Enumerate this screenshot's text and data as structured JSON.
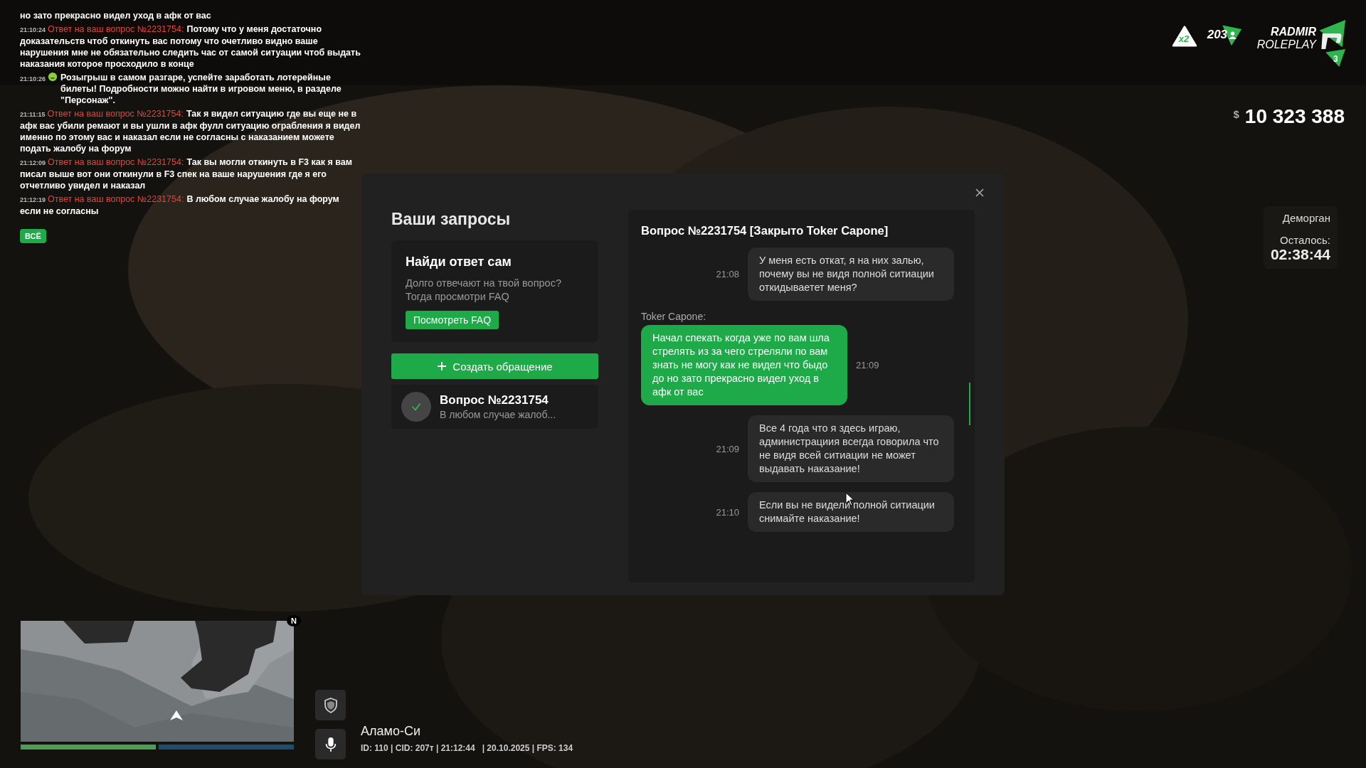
{
  "chat": {
    "messages": [
      {
        "icon": false,
        "text": "но зато прекрасно видел уход в афк от вас"
      },
      {
        "time": "21:10:24",
        "prefix": "Ответ на ваш вопрос №2231754:",
        "icon": false,
        "text": "Потому что у меня достаточно доказательств чтоб откинуть вас потому что очетливо видно ваше нарушения мне не обязательно следить час от самой ситуации чтоб выдать наказания которое просходило в конце"
      },
      {
        "time": "21:10:26",
        "icon": true,
        "text": "Розыгрыш в самом разгаре, успейте заработать лотерейные билеты! Подробности можно найти в игровом меню, в разделе \"Персонаж\"."
      },
      {
        "time": "21:11:15",
        "prefix": "Ответ на ваш вопрос №2231754:",
        "icon": false,
        "text": "Так я видел ситуацию где вы еще не в афк вас убили ремают и вы ушли в афк фулл ситуацию ограбления я видел именно по этому вас и наказал если не согласны с наказанием можете подать жалобу на форум"
      },
      {
        "time": "21:12:09",
        "prefix": "Ответ на ваш вопрос №2231754:",
        "icon": false,
        "text": "Так вы могли откинуть в F3 как я вам писал выше вот они откинули в F3 спек на ваше нарушения где я его отчетливо увидел и наказал"
      },
      {
        "time": "21:12:19",
        "prefix": "Ответ на ваш вопрос №2231754:",
        "icon": false,
        "text": "В любом случае жалобу на форум если не согласны"
      }
    ],
    "filter_button": "ВСЁ"
  },
  "hud": {
    "bonus_badge": "x2",
    "online": "203",
    "logo": {
      "name_top": "RADMIR",
      "name_bottom": "ROLEPLAY",
      "server": "3"
    },
    "money_symbol": "$",
    "money": "10 323 388",
    "jail": {
      "title": "Деморган",
      "remaining_label": "Осталось:",
      "remaining": "02:38:44"
    }
  },
  "modal": {
    "title": "Ваши запросы",
    "help_card": {
      "title": "Найди ответ сам",
      "text": "Долго отвечают на твой вопрос? Тогда просмотри FAQ",
      "button": "Посмотреть FAQ"
    },
    "create_button": "Создать обращение",
    "requests": [
      {
        "title": "Вопрос №2231754",
        "preview": "В любом случае жалоб...",
        "closed": true
      }
    ],
    "conversation": {
      "title": "Вопрос №2231754 [Закрыто Toker Capone]",
      "messages": [
        {
          "kind": "player",
          "time": "21:08",
          "text": "У меня есть откат, я на них залью, почему вы не видя полной ситиации откидываетет меня?"
        },
        {
          "kind": "admin",
          "author": "Toker Capone:",
          "time": "21:09",
          "text": "Начал спекать когда уже по вам шла стрелять из за чего стреляли по вам знать не могу как не видел что быдо до но зато прекрасно видел уход в афк от вас"
        },
        {
          "kind": "player",
          "time": "21:09",
          "text": "Все 4 года что я здесь играю, администрациия всегда говорила что не видя всей ситиации не может выдавать наказание!"
        },
        {
          "kind": "player",
          "time": "21:10",
          "text": "Если вы не видели полной ситиации снимайте наказание!"
        }
      ]
    }
  },
  "minimap": {
    "north": "N"
  },
  "location": "Аламо-Си",
  "status": "ID: 110 | CID: 207т | 21:12:44   | 20.10.2025 | FPS: 134"
}
